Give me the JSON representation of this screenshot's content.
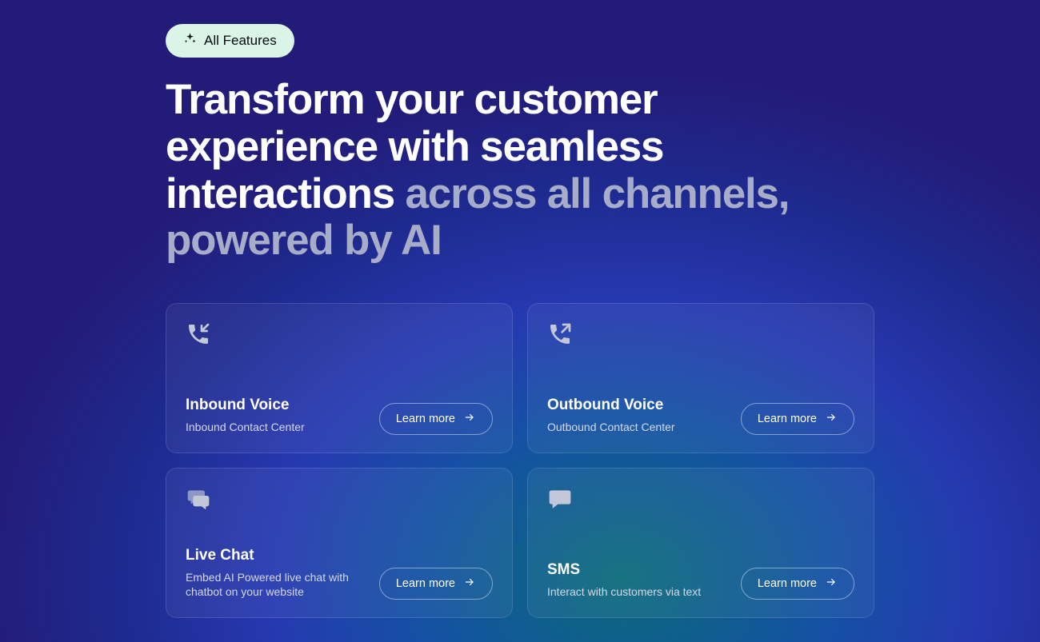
{
  "badge": {
    "label": "All Features"
  },
  "headline": {
    "part1": "Transform your customer experience with seamless interactions ",
    "part2": "across all channels, powered by AI"
  },
  "learn_more_label": "Learn more",
  "cards": [
    {
      "icon": "phone-in",
      "title": "Inbound Voice",
      "desc": "Inbound Contact Center"
    },
    {
      "icon": "phone-out",
      "title": "Outbound Voice",
      "desc": "Outbound Contact Center"
    },
    {
      "icon": "chat",
      "title": "Live Chat",
      "desc": "Embed AI Powered live chat with chatbot on your website"
    },
    {
      "icon": "sms",
      "title": "SMS",
      "desc": "Interact with customers via text"
    }
  ]
}
